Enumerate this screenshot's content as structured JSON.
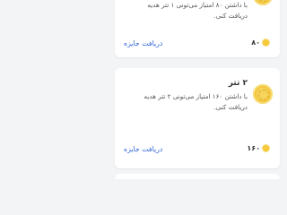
{
  "rewards": [
    {
      "title": "",
      "description_line1": "با داشتن ۸۰ امتیاز می‌تونی ۱ تتر هدیه",
      "description_line2": "دریافت کنی.",
      "claim_label": "دریافت جایزه",
      "points": "۸۰"
    },
    {
      "title": "۲ تتر",
      "description_line1": "با داشتن ۱۶۰ امتیاز می‌تونی ۲ تتر هدیه",
      "description_line2": "دریافت کنی.",
      "claim_label": "دریافت جایزه",
      "points": "۱۶۰"
    }
  ],
  "colors": {
    "accent": "#2f63d8",
    "coin": "#f6c93a",
    "background": "#f3f4f6"
  },
  "icons": {
    "reward": "reward-coin-icon",
    "points": "coin-icon"
  }
}
